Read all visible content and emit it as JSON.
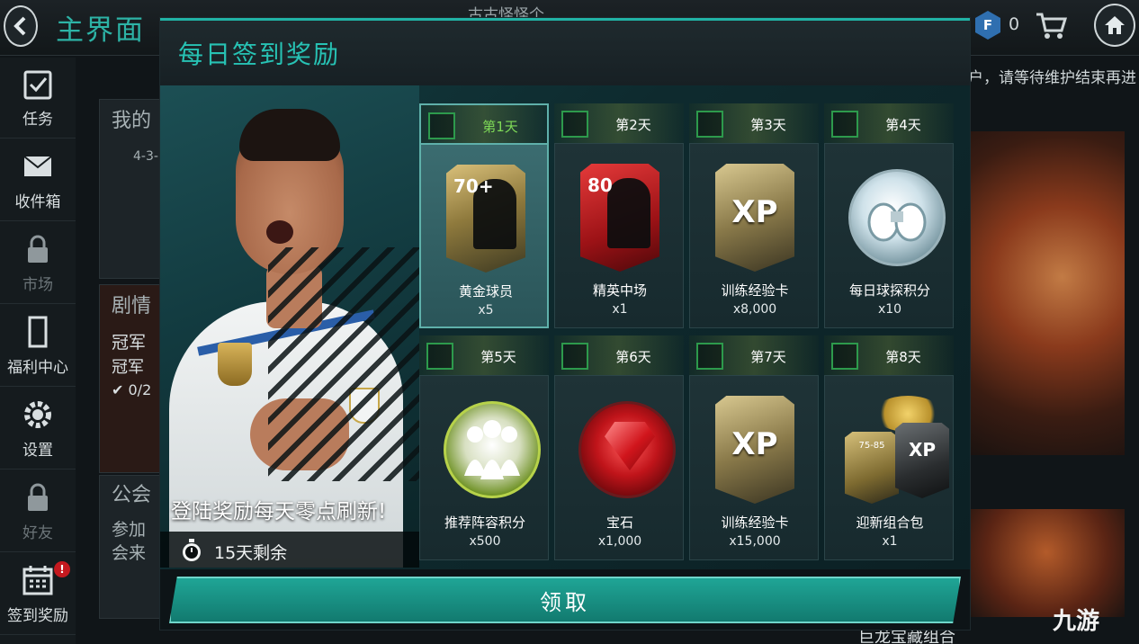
{
  "topbar": {
    "title": "主界面",
    "user_name": "古古怪怪个",
    "fifa_points": "0"
  },
  "sidebar": {
    "items": [
      {
        "label": "任务"
      },
      {
        "label": "收件箱"
      },
      {
        "label": "市场"
      },
      {
        "label": "福利中心"
      },
      {
        "label": "设置"
      },
      {
        "label": "好友"
      },
      {
        "label": "签到奖励",
        "badge": "!"
      }
    ]
  },
  "background": {
    "my_team": "我的",
    "formation": "4-3-",
    "story": "剧情",
    "champion1": "冠军",
    "champion2": "冠军",
    "progress": "✔ 0/2",
    "guild": "公会",
    "join1": "参加",
    "join2": "会来",
    "notice": "户，请等待维护结束再进",
    "bottom_label": "巨龙宝藏组合",
    "watermark": "九游"
  },
  "modal": {
    "title": "每日签到奖励",
    "refresh_text": "登陆奖励每天零点刷新!",
    "time_left": "15天剩余",
    "claim_label": "领取",
    "days": [
      {
        "day": "第1天",
        "name": "黄金球员",
        "qty": "x5",
        "rating": "70+",
        "art": "gold-card",
        "current": true
      },
      {
        "day": "第2天",
        "name": "精英中场",
        "qty": "x1",
        "rating": "80",
        "art": "red-card",
        "current": false
      },
      {
        "day": "第3天",
        "name": "训练经验卡",
        "qty": "x8,000",
        "rating": "XP",
        "art": "xp-card",
        "current": false
      },
      {
        "day": "第4天",
        "name": "每日球探积分",
        "qty": "x10",
        "art": "scout-disc",
        "current": false
      },
      {
        "day": "第5天",
        "name": "推荐阵容积分",
        "qty": "x500",
        "art": "squad-disc",
        "current": false
      },
      {
        "day": "第6天",
        "name": "宝石",
        "qty": "x1,000",
        "art": "gem-disc",
        "current": false
      },
      {
        "day": "第7天",
        "name": "训练经验卡",
        "qty": "x15,000",
        "rating": "XP",
        "art": "xp-card",
        "current": false
      },
      {
        "day": "第8天",
        "name": "迎新组合包",
        "qty": "x1",
        "pack_rating": "75-85",
        "pack_xp": "XP",
        "art": "combo-pack",
        "current": false
      }
    ]
  },
  "colors": {
    "accent": "#27c2b4",
    "claim_button": "#1fa596",
    "current_day_text": "#7ed957",
    "badge_red": "#c4191f"
  }
}
